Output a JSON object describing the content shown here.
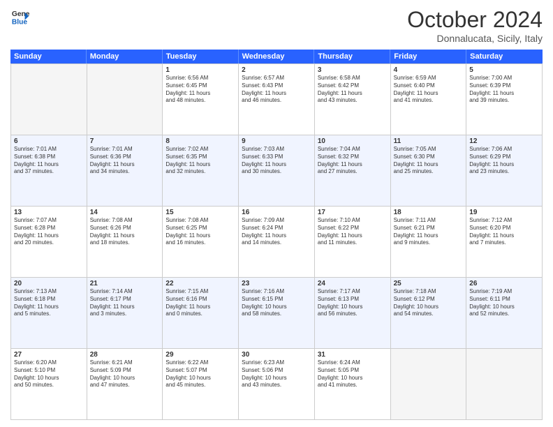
{
  "header": {
    "logo_line1": "General",
    "logo_line2": "Blue",
    "month": "October 2024",
    "location": "Donnalucata, Sicily, Italy"
  },
  "weekdays": [
    "Sunday",
    "Monday",
    "Tuesday",
    "Wednesday",
    "Thursday",
    "Friday",
    "Saturday"
  ],
  "weeks": [
    [
      {
        "day": "",
        "info": "",
        "empty": true
      },
      {
        "day": "",
        "info": "",
        "empty": true
      },
      {
        "day": "1",
        "info": "Sunrise: 6:56 AM\nSunset: 6:45 PM\nDaylight: 11 hours\nand 48 minutes.",
        "empty": false
      },
      {
        "day": "2",
        "info": "Sunrise: 6:57 AM\nSunset: 6:43 PM\nDaylight: 11 hours\nand 46 minutes.",
        "empty": false
      },
      {
        "day": "3",
        "info": "Sunrise: 6:58 AM\nSunset: 6:42 PM\nDaylight: 11 hours\nand 43 minutes.",
        "empty": false
      },
      {
        "day": "4",
        "info": "Sunrise: 6:59 AM\nSunset: 6:40 PM\nDaylight: 11 hours\nand 41 minutes.",
        "empty": false
      },
      {
        "day": "5",
        "info": "Sunrise: 7:00 AM\nSunset: 6:39 PM\nDaylight: 11 hours\nand 39 minutes.",
        "empty": false
      }
    ],
    [
      {
        "day": "6",
        "info": "Sunrise: 7:01 AM\nSunset: 6:38 PM\nDaylight: 11 hours\nand 37 minutes.",
        "empty": false
      },
      {
        "day": "7",
        "info": "Sunrise: 7:01 AM\nSunset: 6:36 PM\nDaylight: 11 hours\nand 34 minutes.",
        "empty": false
      },
      {
        "day": "8",
        "info": "Sunrise: 7:02 AM\nSunset: 6:35 PM\nDaylight: 11 hours\nand 32 minutes.",
        "empty": false
      },
      {
        "day": "9",
        "info": "Sunrise: 7:03 AM\nSunset: 6:33 PM\nDaylight: 11 hours\nand 30 minutes.",
        "empty": false
      },
      {
        "day": "10",
        "info": "Sunrise: 7:04 AM\nSunset: 6:32 PM\nDaylight: 11 hours\nand 27 minutes.",
        "empty": false
      },
      {
        "day": "11",
        "info": "Sunrise: 7:05 AM\nSunset: 6:30 PM\nDaylight: 11 hours\nand 25 minutes.",
        "empty": false
      },
      {
        "day": "12",
        "info": "Sunrise: 7:06 AM\nSunset: 6:29 PM\nDaylight: 11 hours\nand 23 minutes.",
        "empty": false
      }
    ],
    [
      {
        "day": "13",
        "info": "Sunrise: 7:07 AM\nSunset: 6:28 PM\nDaylight: 11 hours\nand 20 minutes.",
        "empty": false
      },
      {
        "day": "14",
        "info": "Sunrise: 7:08 AM\nSunset: 6:26 PM\nDaylight: 11 hours\nand 18 minutes.",
        "empty": false
      },
      {
        "day": "15",
        "info": "Sunrise: 7:08 AM\nSunset: 6:25 PM\nDaylight: 11 hours\nand 16 minutes.",
        "empty": false
      },
      {
        "day": "16",
        "info": "Sunrise: 7:09 AM\nSunset: 6:24 PM\nDaylight: 11 hours\nand 14 minutes.",
        "empty": false
      },
      {
        "day": "17",
        "info": "Sunrise: 7:10 AM\nSunset: 6:22 PM\nDaylight: 11 hours\nand 11 minutes.",
        "empty": false
      },
      {
        "day": "18",
        "info": "Sunrise: 7:11 AM\nSunset: 6:21 PM\nDaylight: 11 hours\nand 9 minutes.",
        "empty": false
      },
      {
        "day": "19",
        "info": "Sunrise: 7:12 AM\nSunset: 6:20 PM\nDaylight: 11 hours\nand 7 minutes.",
        "empty": false
      }
    ],
    [
      {
        "day": "20",
        "info": "Sunrise: 7:13 AM\nSunset: 6:18 PM\nDaylight: 11 hours\nand 5 minutes.",
        "empty": false
      },
      {
        "day": "21",
        "info": "Sunrise: 7:14 AM\nSunset: 6:17 PM\nDaylight: 11 hours\nand 3 minutes.",
        "empty": false
      },
      {
        "day": "22",
        "info": "Sunrise: 7:15 AM\nSunset: 6:16 PM\nDaylight: 11 hours\nand 0 minutes.",
        "empty": false
      },
      {
        "day": "23",
        "info": "Sunrise: 7:16 AM\nSunset: 6:15 PM\nDaylight: 10 hours\nand 58 minutes.",
        "empty": false
      },
      {
        "day": "24",
        "info": "Sunrise: 7:17 AM\nSunset: 6:13 PM\nDaylight: 10 hours\nand 56 minutes.",
        "empty": false
      },
      {
        "day": "25",
        "info": "Sunrise: 7:18 AM\nSunset: 6:12 PM\nDaylight: 10 hours\nand 54 minutes.",
        "empty": false
      },
      {
        "day": "26",
        "info": "Sunrise: 7:19 AM\nSunset: 6:11 PM\nDaylight: 10 hours\nand 52 minutes.",
        "empty": false
      }
    ],
    [
      {
        "day": "27",
        "info": "Sunrise: 6:20 AM\nSunset: 5:10 PM\nDaylight: 10 hours\nand 50 minutes.",
        "empty": false
      },
      {
        "day": "28",
        "info": "Sunrise: 6:21 AM\nSunset: 5:09 PM\nDaylight: 10 hours\nand 47 minutes.",
        "empty": false
      },
      {
        "day": "29",
        "info": "Sunrise: 6:22 AM\nSunset: 5:07 PM\nDaylight: 10 hours\nand 45 minutes.",
        "empty": false
      },
      {
        "day": "30",
        "info": "Sunrise: 6:23 AM\nSunset: 5:06 PM\nDaylight: 10 hours\nand 43 minutes.",
        "empty": false
      },
      {
        "day": "31",
        "info": "Sunrise: 6:24 AM\nSunset: 5:05 PM\nDaylight: 10 hours\nand 41 minutes.",
        "empty": false
      },
      {
        "day": "",
        "info": "",
        "empty": true
      },
      {
        "day": "",
        "info": "",
        "empty": true
      }
    ]
  ]
}
